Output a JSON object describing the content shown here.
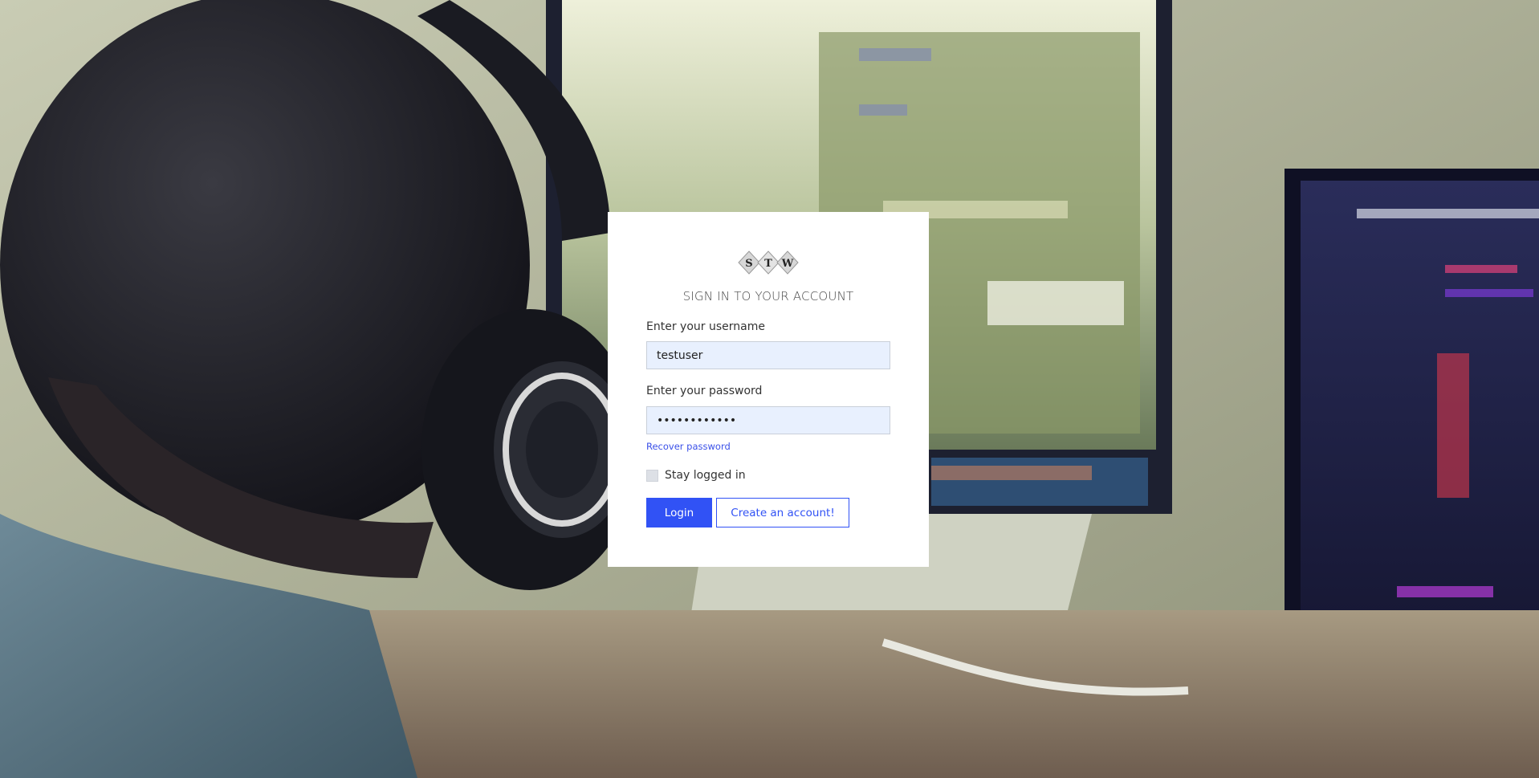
{
  "logo": {
    "letters": [
      "S",
      "T",
      "W"
    ]
  },
  "form": {
    "title": "SIGN IN TO YOUR ACCOUNT",
    "username_label": "Enter your username",
    "username_value": "testuser",
    "password_label": "Enter your password",
    "password_value": "••••••••••••",
    "recover_link": "Recover password",
    "stay_logged_in_label": "Stay logged in",
    "stay_logged_in_checked": false,
    "login_button": "Login",
    "create_account_button": "Create an account!"
  },
  "colors": {
    "accent": "#3152f5",
    "input_bg": "#e8f0fe"
  }
}
